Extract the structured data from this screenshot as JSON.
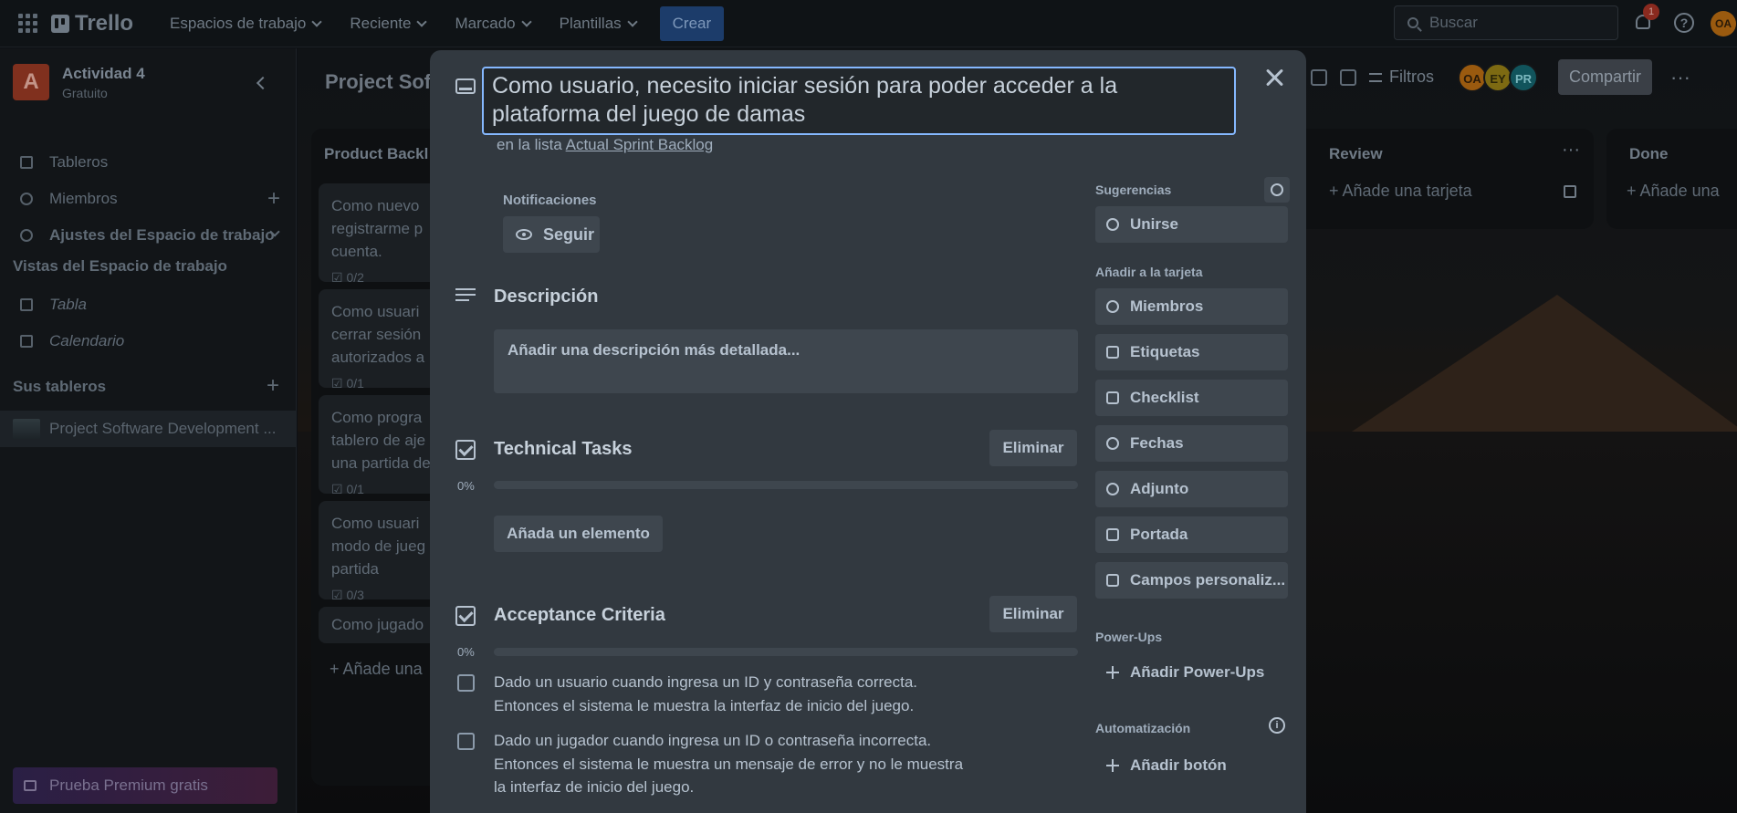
{
  "topbar": {
    "logo": "Trello",
    "menus": [
      "Espacios de trabajo",
      "Reciente",
      "Marcado",
      "Plantillas"
    ],
    "create": "Crear",
    "search_placeholder": "Buscar",
    "notif_count": "1",
    "help": "?",
    "user_initials": "OA"
  },
  "sidebar": {
    "workspace_initial": "A",
    "workspace_name": "Actividad 4",
    "workspace_plan": "Gratuito",
    "items": [
      {
        "label": "Tableros"
      },
      {
        "label": "Miembros"
      },
      {
        "label": "Ajustes del Espacio de trabajo"
      }
    ],
    "views_heading": "Vistas del Espacio de trabajo",
    "views": [
      {
        "label": "Tabla"
      },
      {
        "label": "Calendario"
      }
    ],
    "boards_heading": "Sus tableros",
    "board_name": "Project Software Development ...",
    "premium": "Prueba Premium gratis"
  },
  "board": {
    "title": "Project Sof",
    "filters": "Filtros",
    "members": [
      {
        "initials": "OA",
        "color": "#9a5a0f"
      },
      {
        "initials": "EY",
        "color": "#7d6a12"
      },
      {
        "initials": "PR",
        "color": "#11545c"
      }
    ],
    "share": "Compartir",
    "lists": {
      "backlog": {
        "title": "Product Backl",
        "cards": [
          {
            "text": "Como nuevo\nregistrarme p\ncuenta.",
            "check": "0/2"
          },
          {
            "text": "Como usuari\ncerrar sesión\nautorizados a",
            "check": "0/1"
          },
          {
            "text": "Como progra\ntablero de aje\nuna partida de",
            "check": "0/1"
          },
          {
            "text": "Como usuari\nmodo de jueg\npartida",
            "check": "0/3"
          },
          {
            "text": "Como jugado",
            "check": ""
          }
        ],
        "add": "Añade una"
      },
      "review": {
        "title": "Review",
        "add": "Añade una tarjeta"
      },
      "done": {
        "title": "Done",
        "add": "Añade una"
      }
    }
  },
  "modal": {
    "title": "Como usuario, necesito iniciar sesión para poder acceder a la plataforma del juego de damas",
    "in_list_prefix": "en la lista",
    "list_name": "Actual Sprint Backlog",
    "notifications_label": "Notificaciones",
    "follow": "Seguir",
    "description_title": "Descripción",
    "description_placeholder": "Añadir una descripción más detallada...",
    "checklists": [
      {
        "title": "Technical Tasks",
        "delete": "Eliminar",
        "percent": "0%",
        "progress": 0,
        "add_item": "Añada un elemento"
      },
      {
        "title": "Acceptance Criteria",
        "delete": "Eliminar",
        "percent": "0%",
        "progress": 0
      }
    ],
    "criteria": [
      {
        "line1": "Dado un usuario cuando ingresa un ID y contraseña correcta.",
        "line2": "Entonces el sistema le muestra la interfaz de inicio del juego."
      },
      {
        "line1": "Dado un jugador cuando ingresa un ID o contraseña incorrecta.",
        "line2": "Entonces el sistema le muestra un mensaje de error y no le muestra",
        "line3": "la interfaz de inicio del juego."
      }
    ],
    "sidebar": {
      "suggestions": "Sugerencias",
      "join": "Unirse",
      "add_to_card": "Añadir a la tarjeta",
      "actions": [
        "Miembros",
        "Etiquetas",
        "Checklist",
        "Fechas",
        "Adjunto",
        "Portada",
        "Campos personaliz..."
      ],
      "powerups": "Power-Ups",
      "add_powerups": "Añadir Power-Ups",
      "automation": "Automatización",
      "add_button": "Añadir botón"
    }
  }
}
